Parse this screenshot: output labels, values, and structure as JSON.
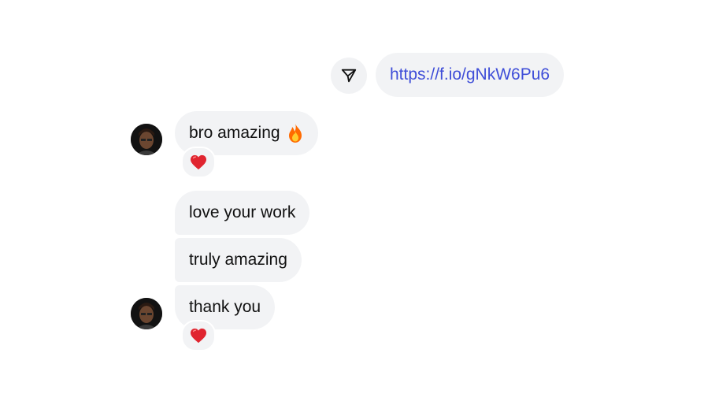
{
  "conversation": {
    "outgoing": {
      "link_text": "https://f.io/gNkW6Pu6",
      "share_icon": "send-paper-plane-icon"
    },
    "incoming_group_1": {
      "avatar_icon": "user-avatar",
      "messages": [
        {
          "text": "bro amazing",
          "emoji_icon": "fire-emoji-icon"
        }
      ],
      "reaction_icon": "red-heart-emoji-icon"
    },
    "incoming_group_2": {
      "avatar_icon": "user-avatar",
      "messages": [
        {
          "text": "love your work"
        },
        {
          "text": "truly amazing"
        },
        {
          "text": "thank you"
        }
      ],
      "reaction_icon": "red-heart-emoji-icon"
    }
  },
  "colors": {
    "bubble_bg": "#f2f3f5",
    "link": "#3f4ed8",
    "text": "#111111",
    "heart": "#e0242f",
    "fire": "#ff7a00"
  }
}
